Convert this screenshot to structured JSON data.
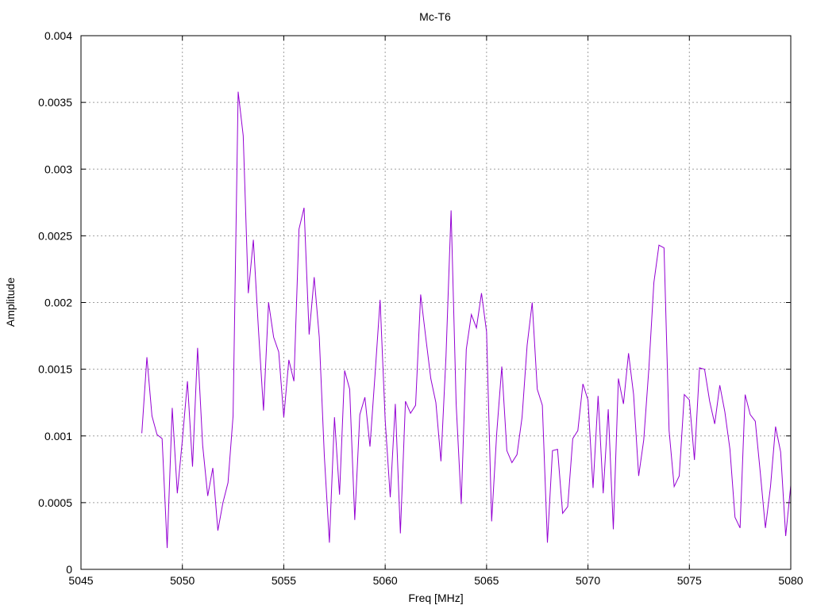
{
  "chart_data": {
    "type": "line",
    "title": "Mc-T6",
    "xlabel": "Freq [MHz]",
    "ylabel": "Amplitude",
    "xlim": [
      5045,
      5080
    ],
    "ylim": [
      0,
      0.004
    ],
    "x_ticks": [
      "5045",
      "5050",
      "5055",
      "5060",
      "5065",
      "5070",
      "5075",
      "5080"
    ],
    "y_ticks": [
      "0",
      "0.0005",
      "0.001",
      "0.0015",
      "0.002",
      "0.0025",
      "0.003",
      "0.0035",
      "0.004"
    ],
    "grid": true,
    "series": [
      {
        "color": "#9400d3",
        "x": [
          5048.0,
          5048.25,
          5048.5,
          5048.75,
          5049.0,
          5049.25,
          5049.5,
          5049.75,
          5050.0,
          5050.25,
          5050.5,
          5050.75,
          5051.0,
          5051.25,
          5051.5,
          5051.75,
          5052.0,
          5052.25,
          5052.5,
          5052.75,
          5053.0,
          5053.25,
          5053.5,
          5053.75,
          5054.0,
          5054.25,
          5054.5,
          5054.75,
          5055.0,
          5055.25,
          5055.5,
          5055.75,
          5056.0,
          5056.25,
          5056.5,
          5056.75,
          5057.0,
          5057.25,
          5057.5,
          5057.75,
          5058.0,
          5058.25,
          5058.5,
          5058.75,
          5059.0,
          5059.25,
          5059.5,
          5059.75,
          5060.0,
          5060.25,
          5060.5,
          5060.75,
          5061.0,
          5061.25,
          5061.5,
          5061.75,
          5062.0,
          5062.25,
          5062.5,
          5062.75,
          5063.0,
          5063.25,
          5063.5,
          5063.75,
          5064.0,
          5064.25,
          5064.5,
          5064.75,
          5065.0,
          5065.25,
          5065.5,
          5065.75,
          5066.0,
          5066.25,
          5066.5,
          5066.75,
          5067.0,
          5067.25,
          5067.5,
          5067.75,
          5068.0,
          5068.25,
          5068.5,
          5068.75,
          5069.0,
          5069.25,
          5069.5,
          5069.75,
          5070.0,
          5070.25,
          5070.5,
          5070.75,
          5071.0,
          5071.25,
          5071.5,
          5071.75,
          5072.0,
          5072.25,
          5072.5,
          5072.75,
          5073.0,
          5073.25,
          5073.5,
          5073.75,
          5074.0,
          5074.25,
          5074.5,
          5074.75,
          5075.0,
          5075.25,
          5075.5,
          5075.75,
          5076.0,
          5076.25,
          5076.5,
          5076.75,
          5077.0,
          5077.25,
          5077.5,
          5077.75,
          5078.0,
          5078.25,
          5078.5,
          5078.75,
          5079.0,
          5079.25,
          5079.5,
          5079.75,
          5080.0
        ],
        "y": [
          0.00102,
          0.00159,
          0.00115,
          0.00101,
          0.00098,
          0.00016,
          0.00121,
          0.00057,
          0.00097,
          0.00141,
          0.00077,
          0.00166,
          0.00093,
          0.00055,
          0.00076,
          0.00029,
          0.0005,
          0.00065,
          0.00115,
          0.00358,
          0.00325,
          0.00207,
          0.00247,
          0.0018,
          0.00119,
          0.002,
          0.00174,
          0.00163,
          0.00114,
          0.00157,
          0.00141,
          0.00255,
          0.00271,
          0.00176,
          0.00219,
          0.00174,
          0.00085,
          0.0002,
          0.00114,
          0.00056,
          0.00149,
          0.00135,
          0.00037,
          0.00116,
          0.00129,
          0.00092,
          0.00146,
          0.00202,
          0.00112,
          0.00054,
          0.00124,
          0.00027,
          0.00126,
          0.00117,
          0.00123,
          0.00206,
          0.00174,
          0.00143,
          0.00125,
          0.00081,
          0.0016,
          0.00269,
          0.00124,
          0.00049,
          0.00165,
          0.00191,
          0.00181,
          0.00207,
          0.00178,
          0.00036,
          0.00102,
          0.00152,
          0.00089,
          0.0008,
          0.00086,
          0.00114,
          0.00168,
          0.002,
          0.00135,
          0.00123,
          0.0002,
          0.00089,
          0.0009,
          0.00042,
          0.00047,
          0.00098,
          0.00104,
          0.00139,
          0.00127,
          0.00061,
          0.0013,
          0.00057,
          0.0012,
          0.0003,
          0.00143,
          0.00124,
          0.00162,
          0.00131,
          0.0007,
          0.00097,
          0.0015,
          0.00215,
          0.00243,
          0.00241,
          0.00104,
          0.00062,
          0.0007,
          0.00131,
          0.00127,
          0.00082,
          0.00151,
          0.0015,
          0.00126,
          0.00109,
          0.00138,
          0.00118,
          0.0009,
          0.00039,
          0.00031,
          0.00131,
          0.00116,
          0.00111,
          0.00072,
          0.00031,
          0.00062,
          0.00107,
          0.00088,
          0.00025,
          0.00063
        ]
      }
    ]
  }
}
